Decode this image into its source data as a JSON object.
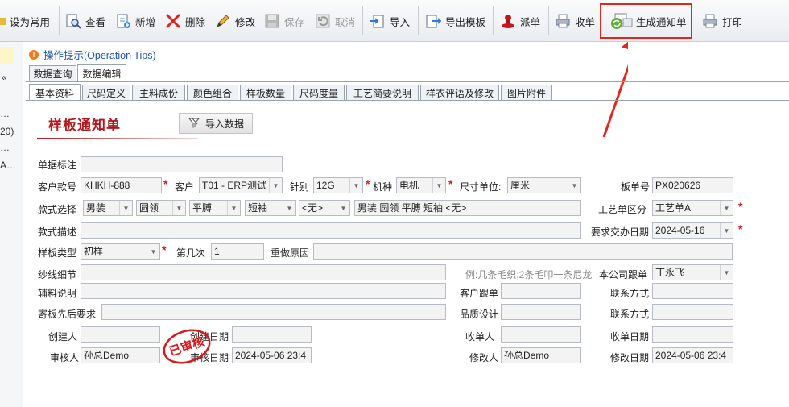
{
  "toolbar": {
    "buttons": [
      {
        "label": "设为常用",
        "icon": "star-icon",
        "enabled": true
      },
      {
        "label": "查看",
        "icon": "view-icon",
        "enabled": true
      },
      {
        "label": "新增",
        "icon": "new-document-icon",
        "enabled": true
      },
      {
        "label": "删除",
        "icon": "delete-icon",
        "enabled": true
      },
      {
        "label": "修改",
        "icon": "pencil-icon",
        "enabled": true
      },
      {
        "label": "保存",
        "icon": "save-icon",
        "enabled": false
      },
      {
        "label": "取消",
        "icon": "undo-icon",
        "enabled": false
      },
      {
        "label": "导入",
        "icon": "import-icon",
        "enabled": true
      },
      {
        "label": "导出模板",
        "icon": "export-template-icon",
        "enabled": true
      },
      {
        "label": "派单",
        "icon": "dispatch-icon",
        "enabled": true
      },
      {
        "label": "收单",
        "icon": "receive-printer-icon",
        "enabled": true
      },
      {
        "label": "生成通知单",
        "icon": "generate-notice-icon",
        "enabled": true
      },
      {
        "label": "打印",
        "icon": "printer-icon",
        "enabled": true
      }
    ],
    "highlight_color": "#e3261c"
  },
  "left_panel": {
    "pin": "ㅁ",
    "collapse": "«",
    "rows": [
      "…",
      "20)",
      "…",
      "A…"
    ]
  },
  "operation_tips": "操作提示(Operation Tips)",
  "outer_tabs": [
    "数据查询",
    "数据编辑"
  ],
  "inner_tabs": [
    "基本资料",
    "尺码定义",
    "主料成份",
    "颜色组合",
    "样板数量",
    "尺码度量",
    "工艺简要说明",
    "样衣评语及修改",
    "图片附件"
  ],
  "form": {
    "title": "样板通知单",
    "import_button": "导入数据",
    "labels": {
      "doc_remark": "单据标注",
      "customer_style_no": "客户款号",
      "customer": "客户",
      "gauge": "针别",
      "machine": "机种",
      "size_unit": "尺寸单位:",
      "board_no": "板单号",
      "style_choice": "款式选择",
      "process_type": "工艺单区分",
      "style_desc": "款式描述",
      "delivery_date": "要求交办日期",
      "sample_type": "样板类型",
      "times": "第几次",
      "redo_reason": "重做原因",
      "yarn_detail": "纱线细节",
      "company_follow": "本公司跟单",
      "accessory": "辅料说明",
      "customer_follow": "客户跟单",
      "contact1": "联系方式",
      "ship_req": "寄板先后要求",
      "quality_design": "品质设计",
      "contact2": "联系方式",
      "creator": "创建人",
      "create_date": "创建日期",
      "receiver": "收单人",
      "receive_date": "收单日期",
      "reviewer": "审核人",
      "review_date": "审核日期",
      "modifier": "修改人",
      "modify_date": "修改日期"
    },
    "values": {
      "doc_remark": "",
      "customer_style_no": "KHKH-888",
      "customer": "T01 - ERP测试",
      "gauge": "12G",
      "machine": "电机",
      "size_unit": "厘米",
      "board_no": "PX020626",
      "style_gender": "男装",
      "style_collar": "圆领",
      "style_sleeve": "平膊",
      "style_length": "短袖",
      "style_none": "<无>",
      "style_summary": "男装  圆领  平膊  短袖  <无>",
      "process_type": "工艺单A",
      "style_desc": "",
      "delivery_date": "2024-05-16",
      "sample_type": "初样",
      "times": "1",
      "redo_reason": "",
      "yarn_detail": "",
      "yarn_hint": "例:几条毛织;2条毛叩一条尼龙",
      "company_follow": "丁永飞",
      "accessory": "",
      "customer_follow": "",
      "contact1": "",
      "ship_req": "",
      "quality_design": "",
      "contact2": "",
      "creator": "",
      "create_date": "",
      "receiver": "",
      "receive_date": "",
      "reviewer": "孙总Demo",
      "review_date": "2024-05-06 23:4",
      "modifier": "孙总Demo",
      "modify_date": "2024-05-06 23:4"
    },
    "required_mark": "*",
    "stamp_text": "已审核",
    "stamp_color": "#d7191c",
    "title_color": "#b3191c"
  }
}
